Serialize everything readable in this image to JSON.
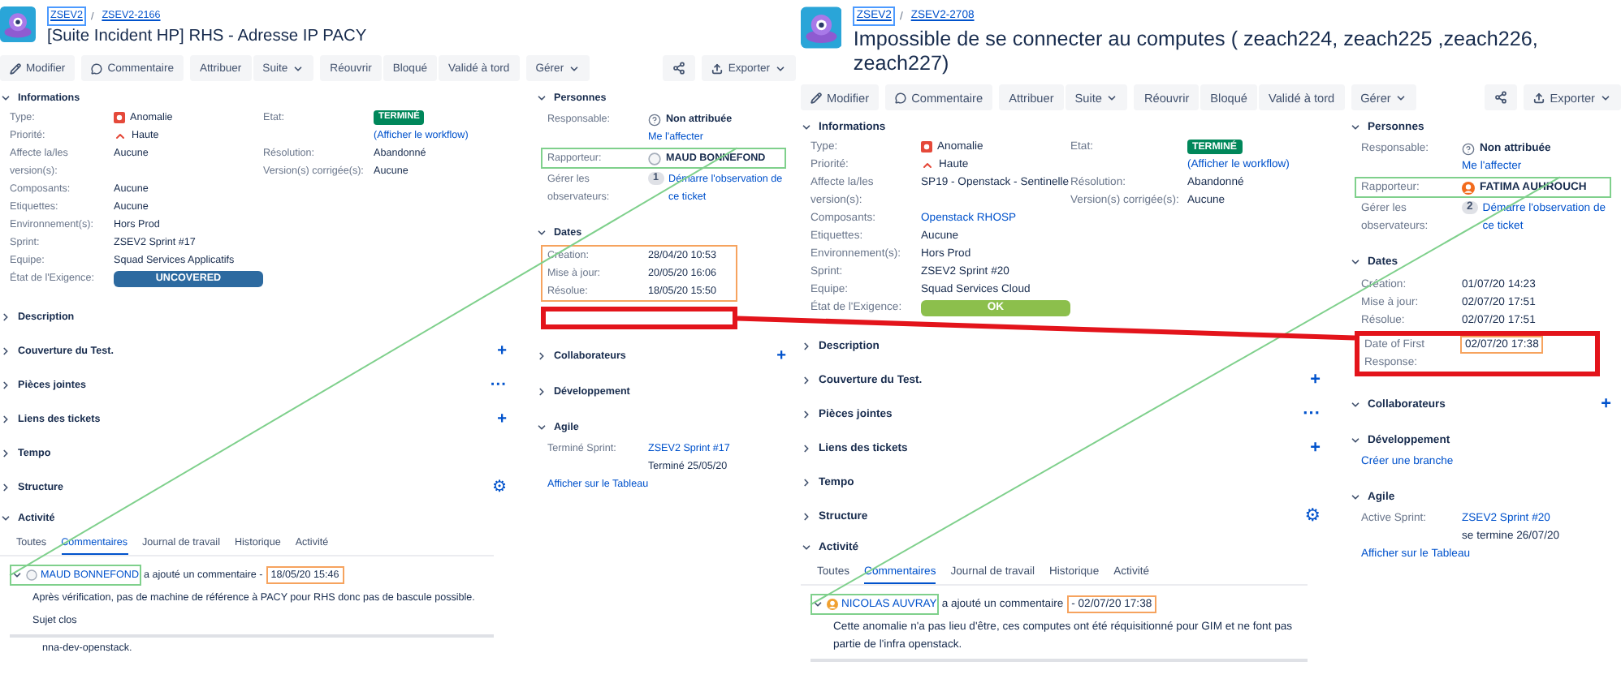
{
  "issues": [
    {
      "breadcrumb": [
        {
          "label": "ZSEV2",
          "focused": true
        },
        {
          "label": "ZSEV2-2166",
          "focused": false
        }
      ],
      "separator": "/",
      "title": "[Suite Incident HP] RHS - Adresse IP PACY",
      "actions": [
        [
          {
            "label": "Modifier",
            "kind": "edit"
          }
        ],
        [
          {
            "label": "Commentaire",
            "kind": "comment"
          }
        ],
        [
          {
            "label": "Attribuer",
            "kind": "plain"
          },
          {
            "label": "Suite",
            "kind": "menu"
          }
        ],
        [
          {
            "label": "Réouvrir",
            "kind": "plain"
          },
          {
            "label": "Bloqué",
            "kind": "plain"
          },
          {
            "label": "Validé à tord",
            "kind": "plain"
          }
        ],
        [
          {
            "label": "Gérer",
            "kind": "menu"
          }
        ]
      ],
      "export": "Exporter",
      "details": {
        "title": "Informations",
        "expanded": true,
        "left": [
          {
            "label": "Type:",
            "value": "Anomalie",
            "kind": "type"
          },
          {
            "label": "Priorité:",
            "value": "Haute",
            "kind": "priority"
          },
          {
            "label": "Affecte la/les version(s):",
            "value": "Aucune",
            "kind": "text"
          },
          {
            "label": "Composants:",
            "value": "Aucune",
            "kind": "text"
          },
          {
            "label": "Etiquettes:",
            "value": "Aucune",
            "kind": "text"
          },
          {
            "label": "Environnement(s):",
            "value": "Hors Prod",
            "kind": "text"
          },
          {
            "label": "Sprint:",
            "value": "ZSEV2 Sprint #17",
            "kind": "text"
          },
          {
            "label": "Equipe:",
            "value": "Squad Services Applicatifs",
            "kind": "text"
          },
          {
            "label": "État de l'Exigence:",
            "value": "UNCOVERED",
            "kind": "bar",
            "color": "#2d6aa0"
          }
        ],
        "right": [
          {
            "label": "Etat:",
            "value": "TERMINÉ",
            "kind": "lozenge",
            "link": "(Afficher le workflow)"
          },
          {
            "label": "Résolution:",
            "value": "Abandonné",
            "kind": "text"
          },
          {
            "label": "Version(s) corrigée(s):",
            "value": "Aucune",
            "kind": "text"
          }
        ]
      },
      "sections": [
        {
          "title": "Description",
          "expanded": false
        },
        {
          "title": "Couverture du Test.",
          "expanded": false,
          "action": "+"
        },
        {
          "title": "Pièces jointes",
          "expanded": false,
          "action": "···"
        },
        {
          "title": "Liens des tickets",
          "expanded": false,
          "action": "+"
        },
        {
          "title": "Tempo",
          "expanded": false
        },
        {
          "title": "Structure",
          "expanded": false,
          "action": "⚙"
        }
      ],
      "activity": {
        "title": "Activité",
        "expanded": true,
        "tabs": [
          {
            "label": "Toutes",
            "selected": false
          },
          {
            "label": "Commentaires",
            "selected": true
          },
          {
            "label": "Journal de travail",
            "selected": false
          },
          {
            "label": "Historique",
            "selected": false
          },
          {
            "label": "Activité",
            "selected": false
          }
        ],
        "comment": {
          "author": "MAUD BONNEFOND",
          "author_highlight": {
            "color": "#7fd08c",
            "heavy": false
          },
          "verb": "a ajouté un commentaire -",
          "date": "18/05/20 15:46",
          "date_highlight": {
            "color": "#f6a35e",
            "heavy": false
          },
          "paragraphs": [
            "Après vérification, pas de machine de référence à PACY pour RHS donc pas de bascule possible.",
            "Sujet clos"
          ]
        },
        "next_excerpt": "nna-dev-openstack."
      },
      "people": {
        "title": "Personnes",
        "expanded": true,
        "rows": [
          {
            "kind": "unassigned",
            "label": "Responsable:",
            "value": "Non attribuée",
            "link": "Me l'affecter"
          },
          {
            "kind": "user",
            "label": "Rapporteur:",
            "value": "MAUD BONNEFOND",
            "highlight": {
              "color": "#7fd08c",
              "heavy": false
            }
          },
          {
            "kind": "watchers",
            "label": "Gérer les observateurs:",
            "count": "1",
            "link": "Démarre l'observation de ce ticket"
          }
        ]
      },
      "dates": {
        "title": "Dates",
        "expanded": true,
        "highlight": {
          "color": "#f6a35e",
          "heavy": false
        },
        "gap_highlight": {
          "color": "#e3141b",
          "heavy": true
        },
        "rows": [
          {
            "label": "Création:",
            "value": "28/04/20 10:53"
          },
          {
            "label": "Mise à jour:",
            "value": "20/05/20 16:06"
          },
          {
            "label": "Résolue:",
            "value": "18/05/20 15:50"
          }
        ]
      },
      "side_sections": [
        {
          "title": "Collaborateurs",
          "expanded": false,
          "action": "+"
        },
        {
          "title": "Développement",
          "expanded": false
        },
        {
          "title": "Agile",
          "expanded": true,
          "sprint": {
            "label": "Terminé Sprint:",
            "link": "ZSEV2 Sprint #17",
            "text": "Terminé 25/05/20"
          },
          "links": [
            "Afficher sur le Tableau"
          ]
        }
      ]
    },
    {
      "breadcrumb": [
        {
          "label": "ZSEV2",
          "focused": true
        },
        {
          "label": "ZSEV2-2708",
          "focused": false
        }
      ],
      "separator": "/",
      "title": "Impossible de se connecter au computes ( zeach224, zeach225 ,zeach226, zeach227)",
      "actions": [
        [
          {
            "label": "Modifier",
            "kind": "edit"
          }
        ],
        [
          {
            "label": "Commentaire",
            "kind": "comment"
          }
        ],
        [
          {
            "label": "Attribuer",
            "kind": "plain"
          },
          {
            "label": "Suite",
            "kind": "menu"
          }
        ],
        [
          {
            "label": "Réouvrir",
            "kind": "plain"
          },
          {
            "label": "Bloqué",
            "kind": "plain"
          },
          {
            "label": "Validé à tord",
            "kind": "plain"
          }
        ],
        [
          {
            "label": "Gérer",
            "kind": "menu"
          }
        ]
      ],
      "export": "Exporter",
      "details": {
        "title": "Informations",
        "expanded": true,
        "left": [
          {
            "label": "Type:",
            "value": "Anomalie",
            "kind": "type"
          },
          {
            "label": "Priorité:",
            "value": "Haute",
            "kind": "priority"
          },
          {
            "label": "Affecte la/les version(s):",
            "value": "SP19 - Openstack - Sentinelle",
            "kind": "text"
          },
          {
            "label": "Composants:",
            "value": "Openstack RHOSP",
            "kind": "link"
          },
          {
            "label": "Etiquettes:",
            "value": "Aucune",
            "kind": "text"
          },
          {
            "label": "Environnement(s):",
            "value": "Hors Prod",
            "kind": "text"
          },
          {
            "label": "Sprint:",
            "value": "ZSEV2 Sprint #20",
            "kind": "text"
          },
          {
            "label": "Equipe:",
            "value": "Squad Services Cloud",
            "kind": "text"
          },
          {
            "label": "État de l'Exigence:",
            "value": "OK",
            "kind": "bar",
            "color": "#8cbf4c"
          }
        ],
        "right": [
          {
            "label": "Etat:",
            "value": "TERMINÉ",
            "kind": "lozenge",
            "link": "(Afficher le workflow)"
          },
          {
            "label": "Résolution:",
            "value": "Abandonné",
            "kind": "text"
          },
          {
            "label": "Version(s) corrigée(s):",
            "value": "Aucune",
            "kind": "text"
          }
        ]
      },
      "sections": [
        {
          "title": "Description",
          "expanded": false
        },
        {
          "title": "Couverture du Test.",
          "expanded": false,
          "action": "+"
        },
        {
          "title": "Pièces jointes",
          "expanded": false,
          "action": "···"
        },
        {
          "title": "Liens des tickets",
          "expanded": false,
          "action": "+"
        },
        {
          "title": "Tempo",
          "expanded": false
        },
        {
          "title": "Structure",
          "expanded": false,
          "action": "⚙"
        }
      ],
      "activity": {
        "title": "Activité",
        "expanded": true,
        "tabs": [
          {
            "label": "Toutes",
            "selected": false
          },
          {
            "label": "Commentaires",
            "selected": true
          },
          {
            "label": "Journal de travail",
            "selected": false
          },
          {
            "label": "Historique",
            "selected": false
          },
          {
            "label": "Activité",
            "selected": false
          }
        ],
        "comment": {
          "author": "NICOLAS AUVRAY",
          "color": "#f0a030",
          "author_highlight": {
            "color": "#7fd08c",
            "heavy": false
          },
          "verb": "a ajouté un commentaire",
          "date": "- 02/07/20 17:38",
          "date_highlight": {
            "color": "#f6a35e",
            "heavy": false
          },
          "paragraphs": [
            "Cette anomalie n'a pas lieu d'être, ces computes ont été réquisitionné pour GIM et ne font pas partie de l'infra openstack."
          ]
        }
      },
      "people": {
        "title": "Personnes",
        "expanded": true,
        "rows": [
          {
            "kind": "unassigned",
            "label": "Responsable:",
            "value": "Non attribuée",
            "link": "Me l'affecter"
          },
          {
            "kind": "user",
            "label": "Rapporteur:",
            "value": "FATIMA AUHROUCH",
            "color": "#f26b1d",
            "highlight": {
              "color": "#7fd08c",
              "heavy": false
            }
          },
          {
            "kind": "watchers",
            "label": "Gérer les observateurs:",
            "count": "2",
            "link": "Démarre l'observation de ce ticket"
          }
        ]
      },
      "dates": {
        "title": "Dates",
        "expanded": true,
        "rows": [
          {
            "label": "Création:",
            "value": "01/07/20 14:23"
          },
          {
            "label": "Mise à jour:",
            "value": "02/07/20 17:51"
          },
          {
            "label": "Résolue:",
            "value": "02/07/20 17:51"
          },
          {
            "label": "Date of First Response:",
            "value": "02/07/20 17:38",
            "highlight": {
              "color": "#e3141b",
              "heavy": true
            },
            "value_highlight": {
              "color": "#f6a35e",
              "heavy": false
            }
          }
        ]
      },
      "side_sections": [
        {
          "title": "Collaborateurs",
          "expanded": true,
          "action": "+"
        },
        {
          "title": "Développement",
          "expanded": true,
          "links": [
            "Créer une branche"
          ]
        },
        {
          "title": "Agile",
          "expanded": true,
          "sprint": {
            "label": "Active Sprint:",
            "link": "ZSEV2 Sprint #20",
            "text": "se termine 26/07/20"
          },
          "links": [
            "Afficher sur le Tableau"
          ]
        }
      ]
    }
  ]
}
